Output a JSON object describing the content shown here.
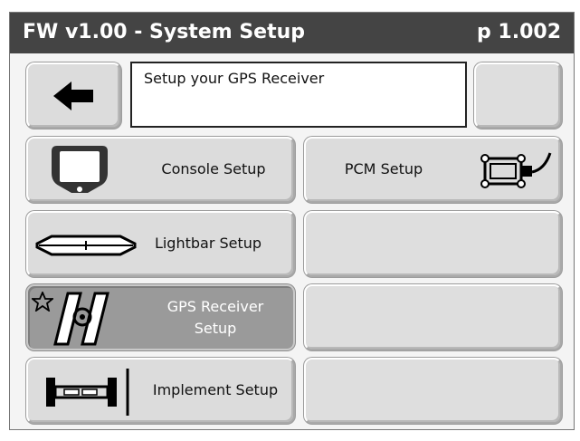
{
  "titlebar": {
    "title": "FW v1.00 - System Setup",
    "page": "p 1.002"
  },
  "info": {
    "text": "Setup your GPS Receiver"
  },
  "buttons": {
    "console": "Console Setup",
    "pcm": "PCM Setup",
    "lightbar": "Lightbar Setup",
    "gps_line1": "GPS Receiver",
    "gps_line2": "Setup",
    "implement": "Implement Setup"
  },
  "icons": {
    "back": "left-arrow-icon",
    "console": "console-icon",
    "pcm": "pcm-module-icon",
    "lightbar": "lightbar-icon",
    "gps": "gps-receiver-icon",
    "gps_star": "star-icon",
    "implement": "implement-icon"
  },
  "colors": {
    "titlebar_bg": "#444444",
    "button_bg": "#dcdcdc",
    "selected_bg": "#9a9a9a"
  }
}
